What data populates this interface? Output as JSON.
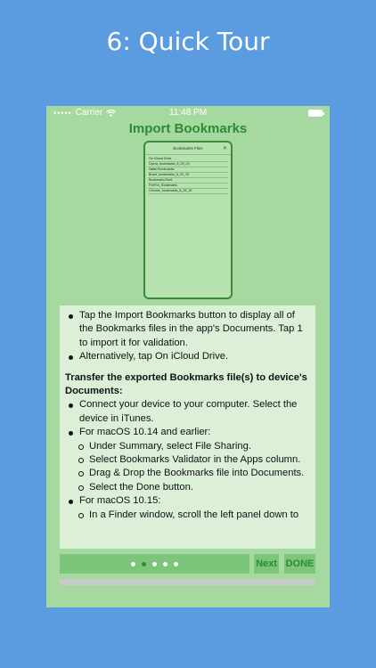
{
  "promo": {
    "title": "6: Quick Tour"
  },
  "status_bar": {
    "dots": "•••••",
    "carrier": "Carrier",
    "wifi_icon": "wifi-icon",
    "time": "11:48 PM",
    "battery_icon": "battery-icon"
  },
  "screen": {
    "title": "Import Bookmarks"
  },
  "mini_phone": {
    "header": "Bookmarks Files",
    "close": "✕",
    "rows": [
      "On iCloud Drive",
      "Opera_bookmarks_8_29_19",
      "Safari Bookmarks",
      "Brave_bookmarks_8_29_19",
      "BookmarksTest1",
      "FireFox_Bookmarks",
      "Chrome_bookmarks_8_26_19"
    ]
  },
  "instructions": {
    "bullets1": [
      "Tap the Import Bookmarks button to display all of the Bookmarks files in the app's Documents. Tap 1 to import it for validation.",
      "Alternatively, tap On iCloud Drive."
    ],
    "heading": "Transfer the exported Bookmarks file(s) to device's Documents:",
    "bullet_connect": "Connect your device to your computer. Select the device in iTunes.",
    "bullet_macos14": "For macOS 10.14 and earlier:",
    "macos14_sub": [
      "Under Summary, select File Sharing.",
      "Select Bookmarks Validator in the Apps column.",
      "Drag & Drop the Bookmarks file into Documents.",
      "Select the Done button."
    ],
    "bullet_macos15": "For macOS 10.15:",
    "macos15_sub": [
      "In a Finder window, scroll the left panel down to"
    ]
  },
  "pager": {
    "count": 5,
    "active_index": 1
  },
  "buttons": {
    "next": "Next",
    "done": "DONE"
  },
  "colors": {
    "background": "#5b9be0",
    "screen": "#a6d9a0",
    "panel": "#dcf0d8",
    "accent": "#2f8a35",
    "button": "#7cc57a"
  }
}
